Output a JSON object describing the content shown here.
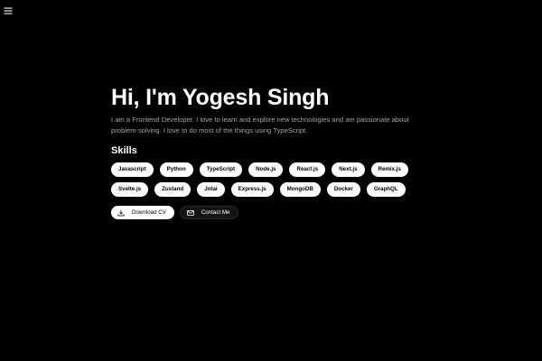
{
  "nav": {
    "menu_icon": "hamburger-menu-icon"
  },
  "hero": {
    "title": "Hi, I'm Yogesh Singh",
    "bio": "I am a Frontend Developer. I love to learn and explore new technologies and am passionate about problem-solving. I love to do most of the things using TypeScript."
  },
  "skills": {
    "heading": "Skills",
    "items": [
      "Javascript",
      "Python",
      "TypeScript",
      "Node.js",
      "React.js",
      "Next.js",
      "Remix.js",
      "Svelte.js",
      "Zustand",
      "Jotai",
      "Express.js",
      "MongoDB",
      "Docker",
      "GraphQL"
    ]
  },
  "actions": {
    "download_cv": {
      "label": "Download CV",
      "icon": "download-icon"
    },
    "contact_me": {
      "label": "Contact Me",
      "icon": "mail-icon"
    }
  },
  "colors": {
    "background": "#000000",
    "text_primary": "#ffffff",
    "text_muted": "#a3a3a3",
    "chip_background": "#ffffff",
    "chip_text": "#000000",
    "secondary_button_background": "#141414"
  }
}
